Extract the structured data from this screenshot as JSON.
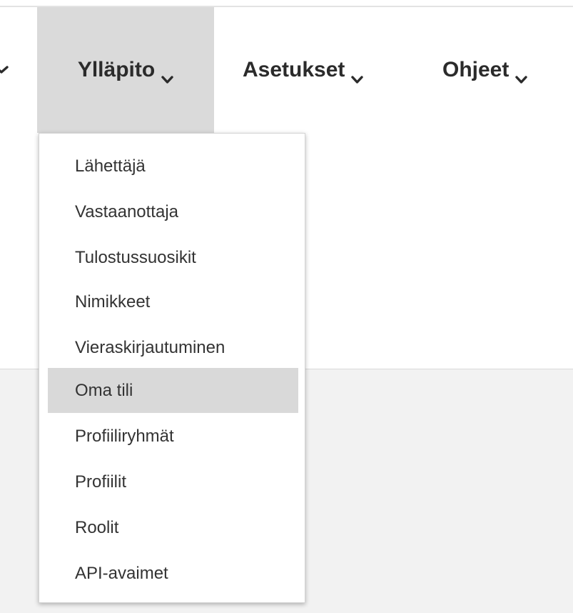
{
  "nav": {
    "items": [
      {
        "label": "Ylläpito",
        "active": true
      },
      {
        "label": "Asetukset",
        "active": false
      },
      {
        "label": "Ohjeet",
        "active": false
      }
    ]
  },
  "dropdown": {
    "items": [
      {
        "label": "Lähettäjä"
      },
      {
        "label": "Vastaanottaja"
      },
      {
        "label": "Tulostussuosikit"
      },
      {
        "label": "Nimikkeet"
      },
      {
        "label": "Vieraskirjautuminen"
      },
      {
        "label": "Oma tili",
        "selected": true
      },
      {
        "label": "Profiiliryhmät"
      },
      {
        "label": "Profiilit"
      },
      {
        "label": "Roolit"
      },
      {
        "label": "API-avaimet"
      }
    ]
  },
  "colors": {
    "active_bg": "#dadada",
    "selected_bg": "#d9d9d9",
    "page_bg": "#f2f2f2",
    "text": "#2b2b2b"
  }
}
